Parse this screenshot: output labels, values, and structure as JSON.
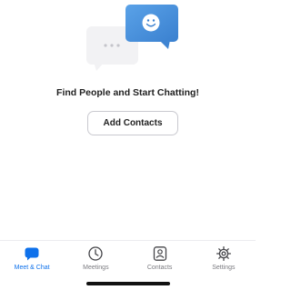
{
  "empty_state": {
    "headline": "Find People and Start Chatting!",
    "add_contacts_label": "Add Contacts"
  },
  "tabs": [
    {
      "label": "Meet & Chat",
      "icon": "chat-bubble-icon",
      "active": true
    },
    {
      "label": "Meetings",
      "icon": "clock-icon",
      "active": false
    },
    {
      "label": "Contacts",
      "icon": "contact-card-icon",
      "active": false
    },
    {
      "label": "Settings",
      "icon": "gear-icon",
      "active": false
    }
  ],
  "colors": {
    "accent": "#0e71eb",
    "inactive": "#7b7b80",
    "bubble_blue": "#4a90d9",
    "bubble_gray": "#f2f2f4"
  }
}
